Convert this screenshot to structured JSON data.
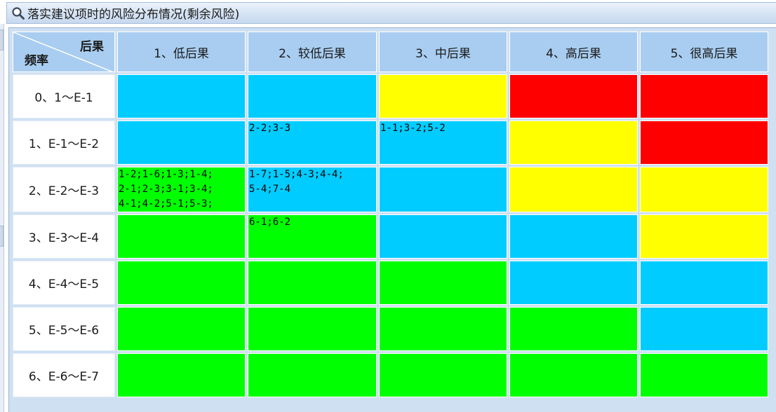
{
  "panel": {
    "title": "落实建议项时的风险分布情况(剩余风险)",
    "icon": "search-icon"
  },
  "matrix": {
    "corner_top": "后果",
    "corner_bottom": "频率",
    "columns": [
      "1、低后果",
      "2、较低后果",
      "3、中后果",
      "4、高后果",
      "5、很高后果"
    ],
    "rows": [
      {
        "label": "0、1～E-1",
        "cells": [
          {
            "color": "blue",
            "text": ""
          },
          {
            "color": "blue",
            "text": ""
          },
          {
            "color": "yellow",
            "text": ""
          },
          {
            "color": "red",
            "text": ""
          },
          {
            "color": "red",
            "text": ""
          }
        ]
      },
      {
        "label": "1、E-1～E-2",
        "cells": [
          {
            "color": "blue",
            "text": ""
          },
          {
            "color": "blue",
            "text": "2-2;3-3"
          },
          {
            "color": "blue",
            "text": "1-1;3-2;5-2"
          },
          {
            "color": "yellow",
            "text": ""
          },
          {
            "color": "red",
            "text": ""
          }
        ]
      },
      {
        "label": "2、E-2～E-3",
        "cells": [
          {
            "color": "green",
            "text": "1-2;1-6;1-3;1-4;\n2-1;2-3;3-1;3-4;\n4-1;4-2;5-1;5-3;"
          },
          {
            "color": "blue",
            "text": "1-7;1-5;4-3;4-4;\n5-4;7-4"
          },
          {
            "color": "blue",
            "text": ""
          },
          {
            "color": "yellow",
            "text": ""
          },
          {
            "color": "yellow",
            "text": ""
          }
        ]
      },
      {
        "label": "3、E-3～E-4",
        "cells": [
          {
            "color": "green",
            "text": ""
          },
          {
            "color": "green",
            "text": "6-1;6-2"
          },
          {
            "color": "blue",
            "text": ""
          },
          {
            "color": "blue",
            "text": ""
          },
          {
            "color": "yellow",
            "text": ""
          }
        ]
      },
      {
        "label": "4、E-4～E-5",
        "cells": [
          {
            "color": "green",
            "text": ""
          },
          {
            "color": "green",
            "text": ""
          },
          {
            "color": "green",
            "text": ""
          },
          {
            "color": "blue",
            "text": ""
          },
          {
            "color": "blue",
            "text": ""
          }
        ]
      },
      {
        "label": "5、E-5～E-6",
        "cells": [
          {
            "color": "green",
            "text": ""
          },
          {
            "color": "green",
            "text": ""
          },
          {
            "color": "green",
            "text": ""
          },
          {
            "color": "green",
            "text": ""
          },
          {
            "color": "blue",
            "text": ""
          }
        ]
      },
      {
        "label": "6、E-6～E-7",
        "cells": [
          {
            "color": "green",
            "text": ""
          },
          {
            "color": "green",
            "text": ""
          },
          {
            "color": "green",
            "text": ""
          },
          {
            "color": "green",
            "text": ""
          },
          {
            "color": "green",
            "text": ""
          }
        ]
      }
    ]
  },
  "colors": {
    "blue": "#00ccff",
    "green": "#00ff00",
    "yellow": "#ffff00",
    "red": "#ff0000",
    "header_bg": "#a8cdf0"
  }
}
